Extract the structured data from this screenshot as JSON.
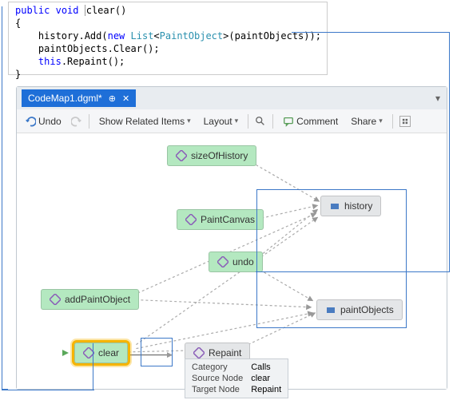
{
  "code": {
    "line1_kw1": "public",
    "line1_kw2": "void",
    "line1_name": "clear()",
    "line2": "{",
    "line3a": "    history.Add(",
    "line3_kw": "new",
    "line3b": " ",
    "line3_type1": "List",
    "line3c": "<",
    "line3_type2": "PaintObject",
    "line3d": ">(paintObjects));",
    "line4": "    paintObjects.Clear();",
    "line5_kw": "this",
    "line5b": ".Repaint();",
    "line6": "}"
  },
  "tab": {
    "title": "CodeMap1.dgml*"
  },
  "toolbar": {
    "undo": "Undo",
    "show_related": "Show Related Items",
    "layout": "Layout",
    "comment": "Comment",
    "share": "Share"
  },
  "nodes": {
    "sizeOfHistory": "sizeOfHistory",
    "history": "history",
    "paintCanvas": "PaintCanvas",
    "undo": "undo",
    "addPaintObject": "addPaintObject",
    "paintObjects": "paintObjects",
    "clear": "clear",
    "repaint": "Repaint"
  },
  "tooltip": {
    "k1": "Category",
    "v1": "Calls",
    "k2": "Source Node",
    "v2": "clear",
    "k3": "Target Node",
    "v3": "Repaint"
  }
}
